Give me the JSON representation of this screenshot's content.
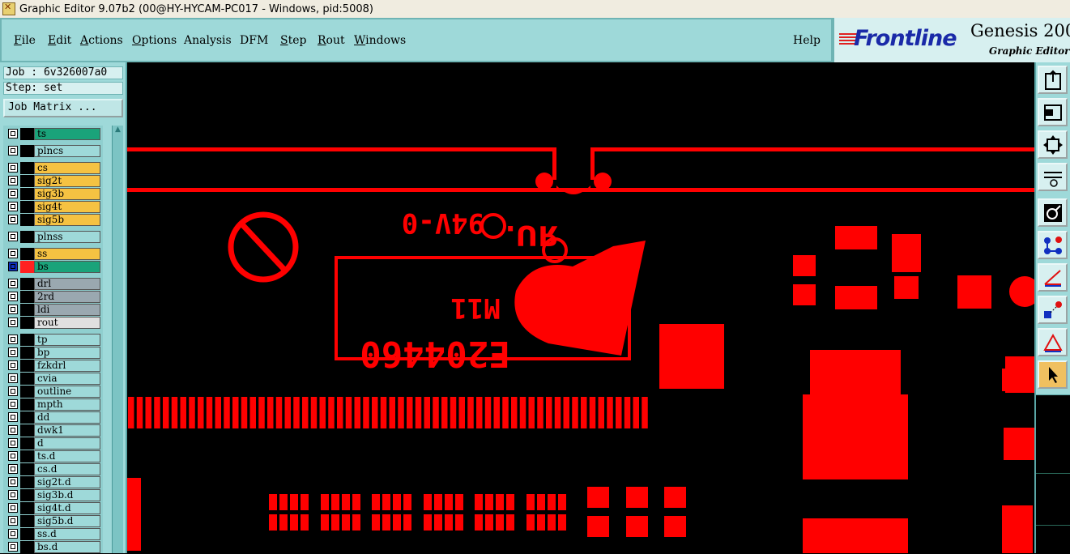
{
  "window": {
    "title": "Graphic Editor 9.07b2 (00@HY-HYCAM-PC017 - Windows, pid:5008)"
  },
  "menu": {
    "items": [
      {
        "label": "File",
        "u": "F",
        "rest": "ile"
      },
      {
        "label": "Edit",
        "u": "E",
        "rest": "dit"
      },
      {
        "label": "Actions",
        "u": "A",
        "rest": "ctions"
      },
      {
        "label": "Options",
        "u": "O",
        "rest": "ptions"
      },
      {
        "label": "Analysis",
        "u": "",
        "rest": "Analysis"
      },
      {
        "label": "DFM",
        "u": "",
        "rest": "DFM"
      },
      {
        "label": "Step",
        "u": "S",
        "rest": "tep"
      },
      {
        "label": "Rout",
        "u": "R",
        "rest": "out"
      },
      {
        "label": "Windows",
        "u": "W",
        "rest": "indows"
      }
    ],
    "help": "Help"
  },
  "logo": {
    "brand": "Frontline",
    "product": "Genesis 2000",
    "subtitle": "Graphic Editor"
  },
  "job": {
    "job_line": "Job : 6v326007a0",
    "step_line": "Step: set",
    "matrix_button": "Job Matrix ..."
  },
  "layers": [
    {
      "name": "ts",
      "color": "#1aa37a"
    },
    {
      "name": "plncs",
      "color": "#9ed9d9"
    },
    {
      "name": "cs",
      "color": "#f5c242"
    },
    {
      "name": "sig2t",
      "color": "#f5c242"
    },
    {
      "name": "sig3b",
      "color": "#f5c242"
    },
    {
      "name": "sig4t",
      "color": "#f5c242"
    },
    {
      "name": "sig5b",
      "color": "#f5c242"
    },
    {
      "name": "plnss",
      "color": "#9ed9d9"
    },
    {
      "name": "ss",
      "color": "#f5c242"
    },
    {
      "name": "bs",
      "color": "#1aa37a",
      "active": true
    },
    {
      "name": "drl",
      "color": "#9aa8b0"
    },
    {
      "name": "2rd",
      "color": "#9aa8b0"
    },
    {
      "name": "ldi",
      "color": "#9aa8b0"
    },
    {
      "name": "rout",
      "color": "#e0e0e0"
    },
    {
      "name": "tp",
      "color": "#9ed9d9"
    },
    {
      "name": "bp",
      "color": "#9ed9d9"
    },
    {
      "name": "fzkdrl",
      "color": "#9ed9d9"
    },
    {
      "name": "cvia",
      "color": "#9ed9d9"
    },
    {
      "name": "outline",
      "color": "#9ed9d9"
    },
    {
      "name": "mpth",
      "color": "#9ed9d9"
    },
    {
      "name": "dd",
      "color": "#9ed9d9"
    },
    {
      "name": "dwk1",
      "color": "#9ed9d9"
    },
    {
      "name": "d",
      "color": "#9ed9d9"
    },
    {
      "name": "ts.d",
      "color": "#9ed9d9"
    },
    {
      "name": "cs.d",
      "color": "#9ed9d9"
    },
    {
      "name": "sig2t.d",
      "color": "#9ed9d9"
    },
    {
      "name": "sig3b.d",
      "color": "#9ed9d9"
    },
    {
      "name": "sig4t.d",
      "color": "#9ed9d9"
    },
    {
      "name": "sig5b.d",
      "color": "#9ed9d9"
    },
    {
      "name": "ss.d",
      "color": "#9ed9d9"
    },
    {
      "name": "bs.d",
      "color": "#9ed9d9"
    }
  ],
  "canvas": {
    "silk_text_1": "94V-0",
    "silk_text_2": "E204460",
    "silk_text_3": "M11",
    "feature_color": "#ff0000"
  },
  "toolbar": {
    "buttons": [
      "clipboard-icon",
      "zoom-back-icon",
      "zoom-fit-icon",
      "tools-icon",
      "snap-icon",
      "connect-icon",
      "measure-icon",
      "select-points-icon",
      "triangle-icon",
      "pointer-icon"
    ],
    "selected": "pointer-icon"
  }
}
